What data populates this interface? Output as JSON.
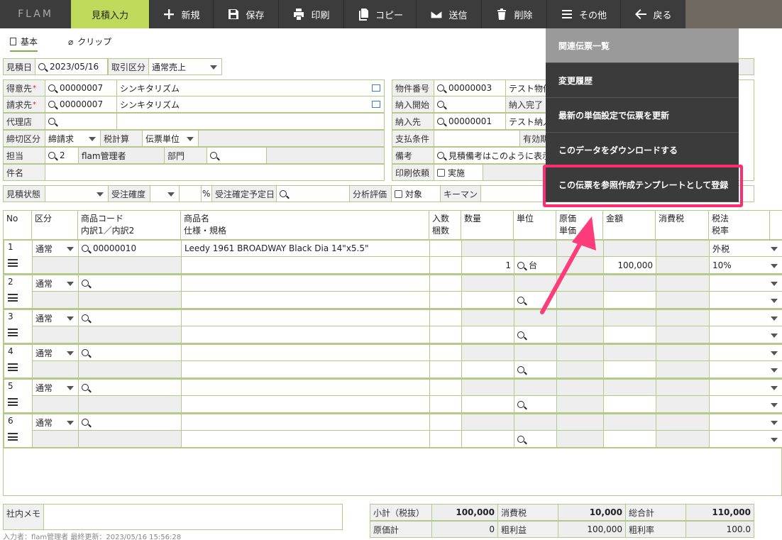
{
  "toolbar": {
    "logo": "FLAM",
    "active_tab": "見積入力",
    "new": "新規",
    "save": "保存",
    "print": "印刷",
    "copy": "コピー",
    "send": "送信",
    "delete": "削除",
    "other": "その他",
    "back": "戻る"
  },
  "tabs": {
    "basic": "基本",
    "clip": "クリップ"
  },
  "header": {
    "date_label": "見積日",
    "date_value": "2023/05/16",
    "trade_label": "取引区分",
    "trade_value": "通常売上",
    "customer_label": "得意先",
    "customer_code": "00000007",
    "customer_name": "シンキタリズム",
    "billing_label": "請求先",
    "billing_code": "00000007",
    "billing_name": "シンキタリズム",
    "agent_label": "代理店",
    "closing_label": "締切区分",
    "closing_value": "締請求",
    "tax_calc_label": "税計算",
    "tax_calc_value": "伝票単位",
    "staff_label": "担当",
    "staff_code": "2",
    "staff_name": "flam管理者",
    "dept_label": "部門",
    "subject_label": "件名",
    "property_label": "物件番号",
    "property_code": "00000003",
    "property_name": "テスト物件",
    "delivery_start_label": "納入開始",
    "delivery_end_label": "納入完了",
    "delivery_to_label": "納入先",
    "delivery_to_code": "00000001",
    "delivery_to_name": "テスト納入",
    "payment_label": "支払条件",
    "validity_label": "有効期",
    "memo_label": "備考",
    "memo_value": "見積備考はこのように表示",
    "print_req_label": "印刷依頼",
    "print_req_check": "実施",
    "est_status_label": "見積状態",
    "order_conf_label": "受注確度",
    "percent": "%",
    "order_date_label": "受注確定予定日",
    "analysis_label": "分析評価",
    "analysis_check": "対象",
    "keyman_label": "キーマン"
  },
  "table": {
    "headers": {
      "no": "No",
      "kubun": "区分",
      "code": "商品コード",
      "code2": "内訳1／内訳2",
      "name": "商品名",
      "name2": "仕様・規格",
      "irisu": "入数",
      "irisu2": "梱数",
      "qty": "数量",
      "unit": "単位",
      "cost": "原価",
      "cost2": "単価",
      "amount": "金額",
      "tax": "消費税",
      "taxm": "税法",
      "taxm2": "税率"
    },
    "rows": [
      {
        "no": "1",
        "kubun": "通常",
        "code": "00000010",
        "name": "Leedy 1961 BROADWAY Black Dia 14\"x5.5\"",
        "qty": "1",
        "unit": "台",
        "amount": "100,000",
        "taxm": "外税",
        "taxrate": "10%"
      },
      {
        "no": "2",
        "kubun": "通常"
      },
      {
        "no": "3",
        "kubun": "通常"
      },
      {
        "no": "4",
        "kubun": "通常"
      },
      {
        "no": "5",
        "kubun": "通常"
      },
      {
        "no": "6",
        "kubun": "通常"
      }
    ]
  },
  "footer": {
    "memo_label": "社内メモ",
    "subtotal_label": "小計（税抜）",
    "subtotal": "100,000",
    "tax_label": "消費税",
    "tax": "10,000",
    "total_label": "総合計",
    "total": "110,000",
    "cost_label": "原価計",
    "cost": "0",
    "profit_label": "粗利益",
    "profit": "100,000",
    "margin_label": "粗利率",
    "margin": "100.0",
    "status": "入力者：flam管理者 最終更新：2023/05/16 15:56:28"
  },
  "menu": {
    "items": [
      "関連伝票一覧",
      "変更履歴",
      "最新の単価設定で伝票を更新",
      "このデータをダウンロードする",
      "この伝票を参照作成テンプレートとして登録"
    ]
  },
  "colors": {
    "toolbar": "#3c3c3c",
    "active": "#bfd95a",
    "border": "#b5c98a",
    "highlight": "#ff2d6f"
  }
}
